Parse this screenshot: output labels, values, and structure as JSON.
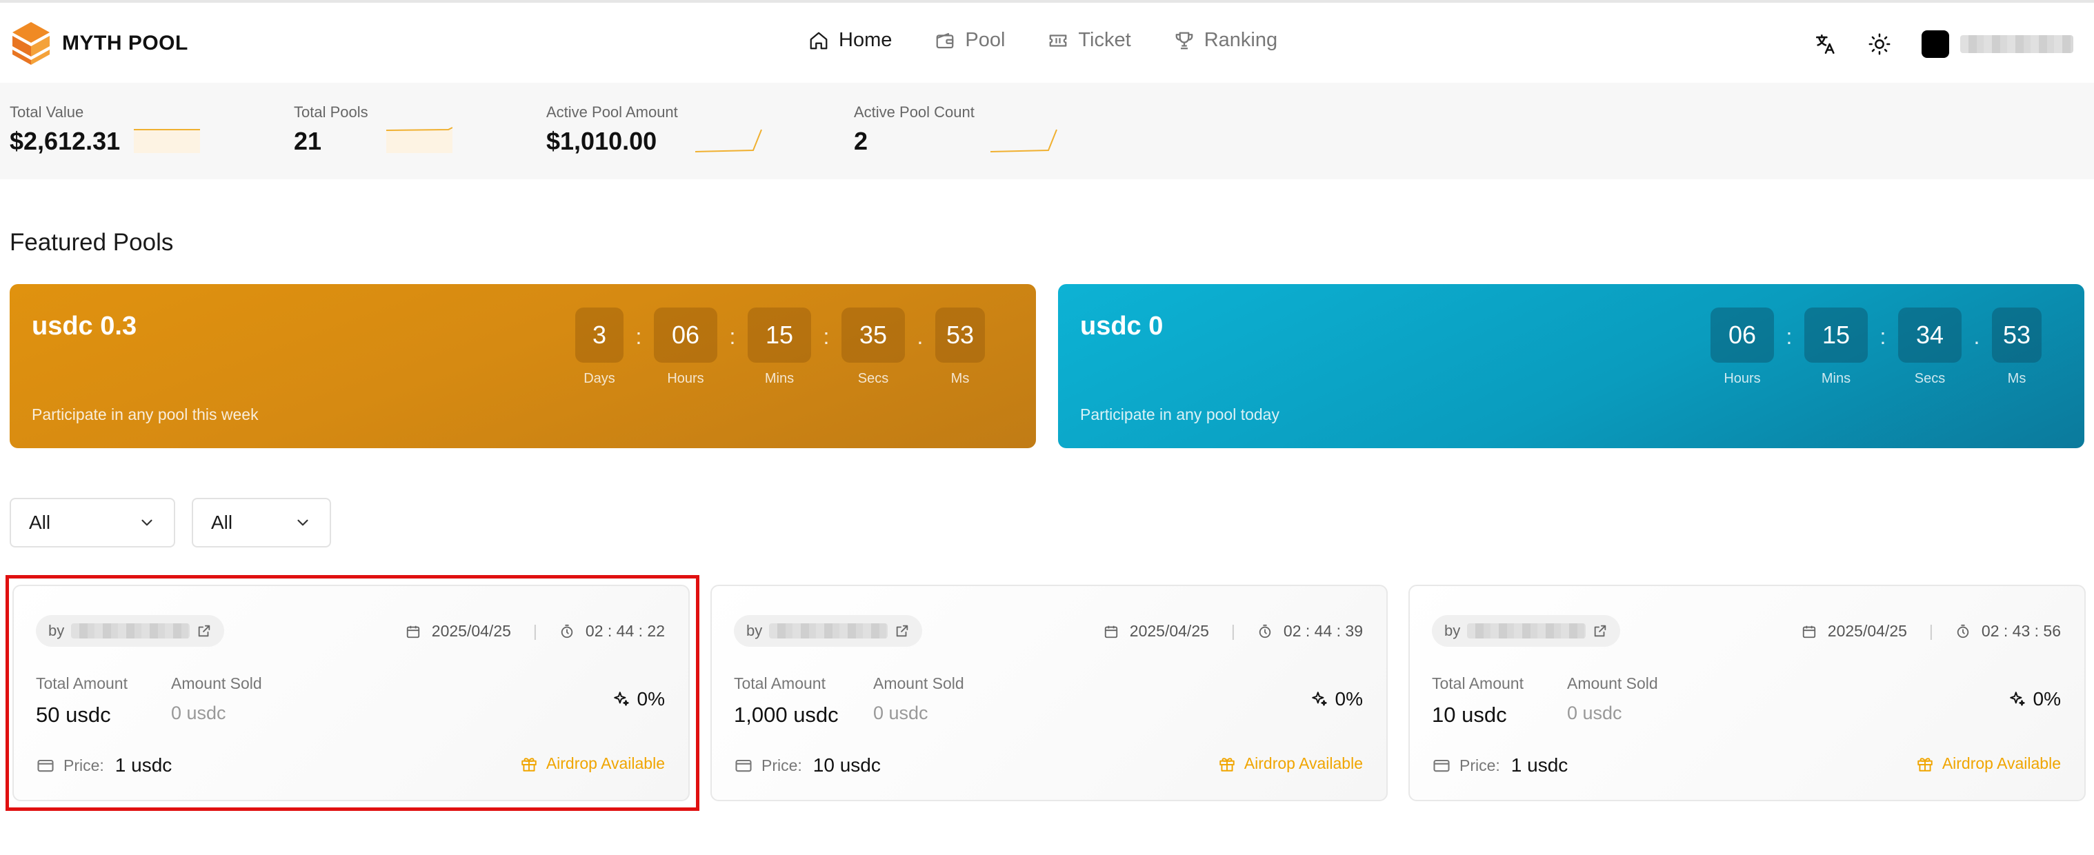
{
  "brand": {
    "name": "MYTH POOL",
    "accent": "#f0a500"
  },
  "nav": [
    {
      "label": "Home",
      "icon": "home-icon",
      "active": true
    },
    {
      "label": "Pool",
      "icon": "wallet-icon",
      "active": false
    },
    {
      "label": "Ticket",
      "icon": "ticket-icon",
      "active": false
    },
    {
      "label": "Ranking",
      "icon": "trophy-icon",
      "active": false
    }
  ],
  "header_right": {
    "translate_icon": "translate-icon",
    "theme_icon": "sun-icon"
  },
  "stats": [
    {
      "label": "Total Value",
      "value": "$2,612.31"
    },
    {
      "label": "Total Pools",
      "value": "21"
    },
    {
      "label": "Active Pool Amount",
      "value": "$1,010.00"
    },
    {
      "label": "Active Pool Count",
      "value": "2"
    }
  ],
  "featured": {
    "title": "Featured Pools",
    "pools": [
      {
        "title": "usdc 0.3",
        "subtitle": "Participate in any pool this week",
        "timer": [
          {
            "value": "3",
            "label": "Days"
          },
          {
            "value": "06",
            "label": "Hours"
          },
          {
            "value": "15",
            "label": "Mins"
          },
          {
            "value": "35",
            "label": "Secs"
          },
          {
            "value": "53",
            "label": "Ms"
          }
        ],
        "separators": [
          ":",
          ":",
          ":",
          "."
        ]
      },
      {
        "title": "usdc 0",
        "subtitle": "Participate in any pool today",
        "timer": [
          {
            "value": "06",
            "label": "Hours"
          },
          {
            "value": "15",
            "label": "Mins"
          },
          {
            "value": "34",
            "label": "Secs"
          },
          {
            "value": "53",
            "label": "Ms"
          }
        ],
        "separators": [
          ":",
          ":",
          "."
        ]
      }
    ]
  },
  "filters": [
    {
      "value": "All"
    },
    {
      "value": "All"
    }
  ],
  "cards": [
    {
      "by": "by",
      "date": "2025/04/25",
      "time": "02 : 44 : 22",
      "total_label": "Total Amount",
      "total_value": "50 usdc",
      "sold_label": "Amount Sold",
      "sold_value": "0 usdc",
      "percent": "0%",
      "price_label": "Price:",
      "price_value": "1 usdc",
      "airdrop": "Airdrop Available"
    },
    {
      "by": "by",
      "date": "2025/04/25",
      "time": "02 : 44 : 39",
      "total_label": "Total Amount",
      "total_value": "1,000 usdc",
      "sold_label": "Amount Sold",
      "sold_value": "0 usdc",
      "percent": "0%",
      "price_label": "Price:",
      "price_value": "10 usdc",
      "airdrop": "Airdrop Available"
    },
    {
      "by": "by",
      "date": "2025/04/25",
      "time": "02 : 43 : 56",
      "total_label": "Total Amount",
      "total_value": "10 usdc",
      "sold_label": "Amount Sold",
      "sold_value": "0 usdc",
      "percent": "0%",
      "price_label": "Price:",
      "price_value": "1 usdc",
      "airdrop": "Airdrop Available"
    }
  ]
}
